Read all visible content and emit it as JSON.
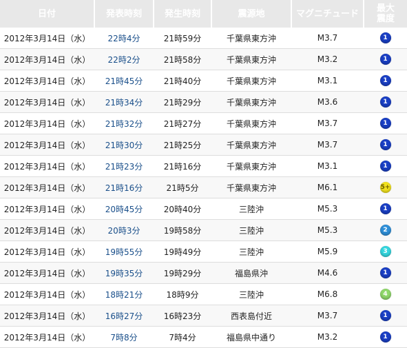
{
  "header": {
    "date": "日付",
    "published": "発表時刻",
    "occurred": "発生時刻",
    "epicenter": "震源地",
    "magnitude": "マグニチュード",
    "max_intensity_line1": "最大",
    "max_intensity_line2": "震度"
  },
  "intensity_colors": {
    "1": {
      "bg": "#1a3fc4",
      "fg": "#ffffff"
    },
    "2": {
      "bg": "#2f8fd8",
      "fg": "#ffffff"
    },
    "3": {
      "bg": "#35d6de",
      "fg": "#ffffff"
    },
    "4": {
      "bg": "#8fd86a",
      "fg": "#ffffff"
    },
    "5+": {
      "bg": "#f1e21e",
      "fg": "#6a5a00"
    }
  },
  "rows": [
    {
      "date": "2012年3月14日（水）",
      "published": "22時4分",
      "occurred": "21時59分",
      "epicenter": "千葉県東方沖",
      "magnitude": "M3.7",
      "intensity": "1"
    },
    {
      "date": "2012年3月14日（水）",
      "published": "22時2分",
      "occurred": "21時58分",
      "epicenter": "千葉県東方沖",
      "magnitude": "M3.2",
      "intensity": "1"
    },
    {
      "date": "2012年3月14日（水）",
      "published": "21時45分",
      "occurred": "21時40分",
      "epicenter": "千葉県東方沖",
      "magnitude": "M3.1",
      "intensity": "1"
    },
    {
      "date": "2012年3月14日（水）",
      "published": "21時34分",
      "occurred": "21時29分",
      "epicenter": "千葉県東方沖",
      "magnitude": "M3.6",
      "intensity": "1"
    },
    {
      "date": "2012年3月14日（水）",
      "published": "21時32分",
      "occurred": "21時27分",
      "epicenter": "千葉県東方沖",
      "magnitude": "M3.7",
      "intensity": "1"
    },
    {
      "date": "2012年3月14日（水）",
      "published": "21時30分",
      "occurred": "21時25分",
      "epicenter": "千葉県東方沖",
      "magnitude": "M3.7",
      "intensity": "1"
    },
    {
      "date": "2012年3月14日（水）",
      "published": "21時23分",
      "occurred": "21時16分",
      "epicenter": "千葉県東方沖",
      "magnitude": "M3.1",
      "intensity": "1"
    },
    {
      "date": "2012年3月14日（水）",
      "published": "21時16分",
      "occurred": "21時5分",
      "epicenter": "千葉県東方沖",
      "magnitude": "M6.1",
      "intensity": "5+"
    },
    {
      "date": "2012年3月14日（水）",
      "published": "20時45分",
      "occurred": "20時40分",
      "epicenter": "三陸沖",
      "magnitude": "M5.3",
      "intensity": "1"
    },
    {
      "date": "2012年3月14日（水）",
      "published": "20時3分",
      "occurred": "19時58分",
      "epicenter": "三陸沖",
      "magnitude": "M5.3",
      "intensity": "2"
    },
    {
      "date": "2012年3月14日（水）",
      "published": "19時55分",
      "occurred": "19時49分",
      "epicenter": "三陸沖",
      "magnitude": "M5.9",
      "intensity": "3"
    },
    {
      "date": "2012年3月14日（水）",
      "published": "19時35分",
      "occurred": "19時29分",
      "epicenter": "福島県沖",
      "magnitude": "M4.6",
      "intensity": "1"
    },
    {
      "date": "2012年3月14日（水）",
      "published": "18時21分",
      "occurred": "18時9分",
      "epicenter": "三陸沖",
      "magnitude": "M6.8",
      "intensity": "4"
    },
    {
      "date": "2012年3月14日（水）",
      "published": "16時27分",
      "occurred": "16時23分",
      "epicenter": "西表島付近",
      "magnitude": "M3.7",
      "intensity": "1"
    },
    {
      "date": "2012年3月14日（水）",
      "published": "7時8分",
      "occurred": "7時4分",
      "epicenter": "福島県中通り",
      "magnitude": "M3.2",
      "intensity": "1"
    }
  ]
}
